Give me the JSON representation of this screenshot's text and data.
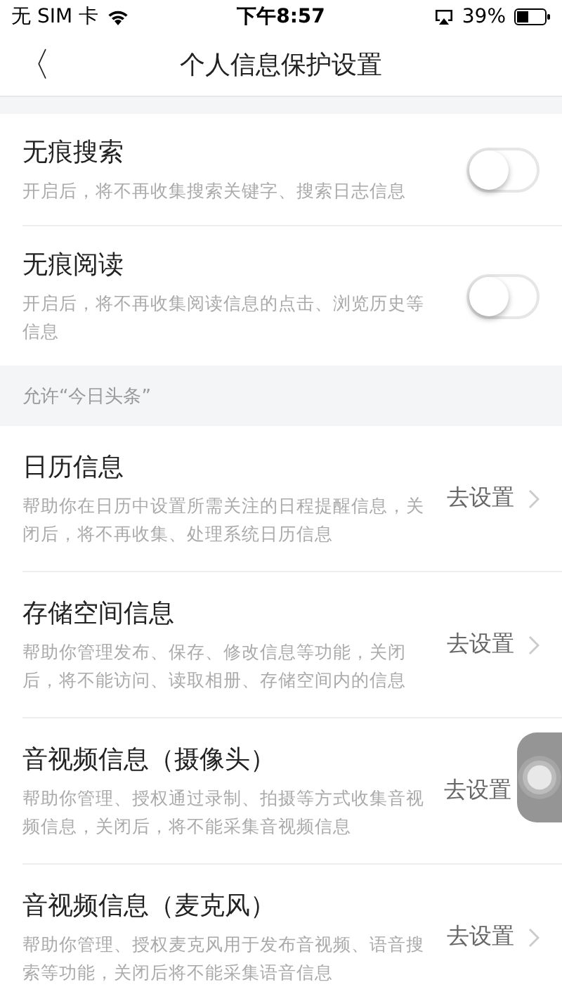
{
  "status_bar": {
    "carrier": "无 SIM 卡",
    "time": "下午8:57",
    "battery": "39%"
  },
  "nav": {
    "back": "〈",
    "title": "个人信息保护设置"
  },
  "sections": [
    {
      "items": [
        {
          "kind": "toggle",
          "title": "无痕搜索",
          "desc": "开启后，将不再收集搜索关键字、搜索日志信息",
          "on": false
        },
        {
          "kind": "toggle",
          "title": "无痕阅读",
          "desc": "开启后，将不再收集阅读信息的点击、浏览历史等信息",
          "on": false
        }
      ]
    },
    {
      "header": "允许“今日头条”",
      "items": [
        {
          "kind": "link",
          "title": "日历信息",
          "desc": "帮助你在日历中设置所需关注的日程提醒信息，关闭后，将不再收集、处理系统日历信息",
          "action": "去设置",
          "chevron": true
        },
        {
          "kind": "link",
          "title": "存储空间信息",
          "desc": "帮助你管理发布、保存、修改信息等功能，关闭后，将不能访问、读取相册、存储空间内的信息",
          "action": "去设置",
          "chevron": true
        },
        {
          "kind": "link",
          "title": "音视频信息（摄像头）",
          "desc": "帮助你管理、授权通过录制、拍摄等方式收集音视频信息，关闭后，将不能采集音视频信息",
          "action": "去设置",
          "chevron": false
        },
        {
          "kind": "link",
          "title": "音视频信息（麦克风）",
          "desc": "帮助你管理、授权麦克风用于发布音视频、语音搜索等功能，关闭后将不能采集语音信息",
          "action": "去设置",
          "chevron": true
        }
      ]
    }
  ]
}
